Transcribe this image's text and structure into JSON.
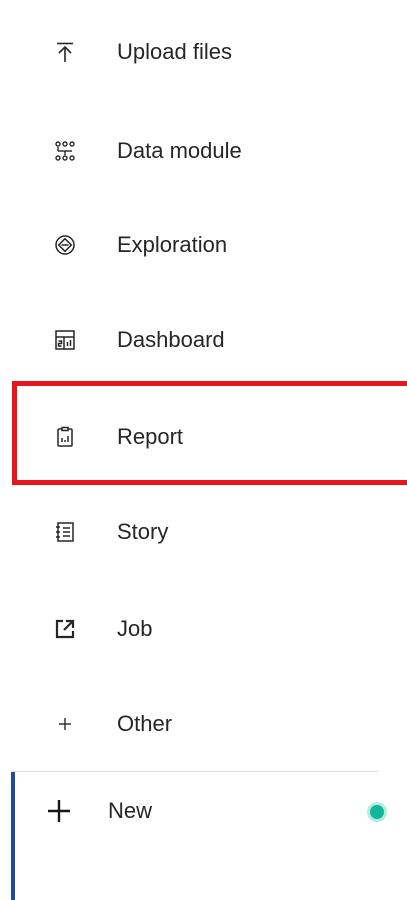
{
  "menu": {
    "items": [
      {
        "label": "Upload files",
        "icon": "upload-icon"
      },
      {
        "label": "Data module",
        "icon": "data-module-icon"
      },
      {
        "label": "Exploration",
        "icon": "exploration-icon"
      },
      {
        "label": "Dashboard",
        "icon": "dashboard-icon"
      },
      {
        "label": "Report",
        "icon": "report-icon"
      },
      {
        "label": "Story",
        "icon": "story-icon"
      },
      {
        "label": "Job",
        "icon": "launch-icon"
      },
      {
        "label": "Other",
        "icon": "plus-icon"
      }
    ],
    "highlighted_item": "Report",
    "highlight_color": "#e8141e"
  },
  "new_button": {
    "label": "New",
    "icon": "plus-icon",
    "accent_color": "#1f4c98",
    "status_color": "#12b59a"
  }
}
